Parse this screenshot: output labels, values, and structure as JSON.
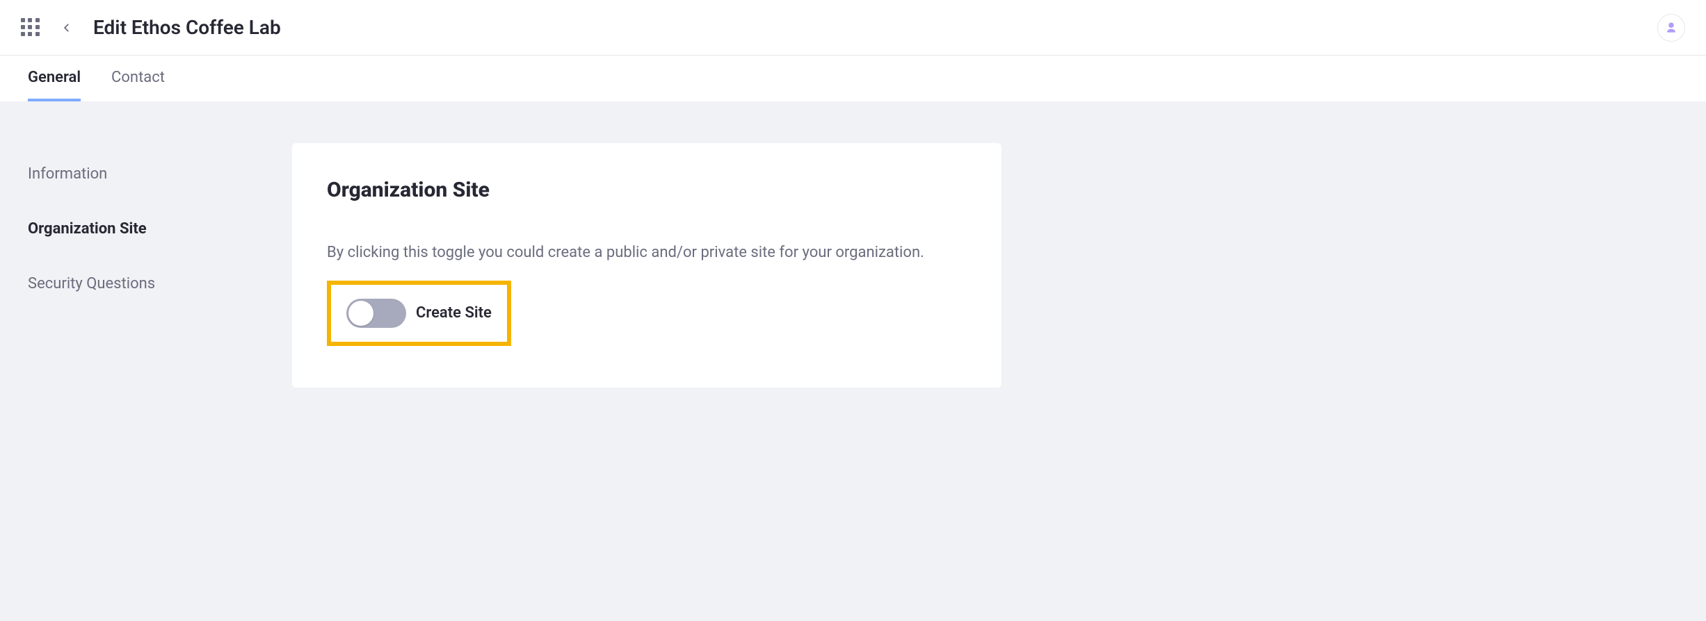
{
  "header": {
    "title": "Edit Ethos Coffee Lab"
  },
  "tabs": [
    {
      "label": "General",
      "active": true
    },
    {
      "label": "Contact",
      "active": false
    }
  ],
  "sidenav": {
    "items": [
      {
        "label": "Information",
        "active": false
      },
      {
        "label": "Organization Site",
        "active": true
      },
      {
        "label": "Security Questions",
        "active": false
      }
    ]
  },
  "panel": {
    "title": "Organization Site",
    "description": "By clicking this toggle you could create a public and/or private site for your organization.",
    "toggle_label": "Create Site",
    "toggle_on": false
  }
}
